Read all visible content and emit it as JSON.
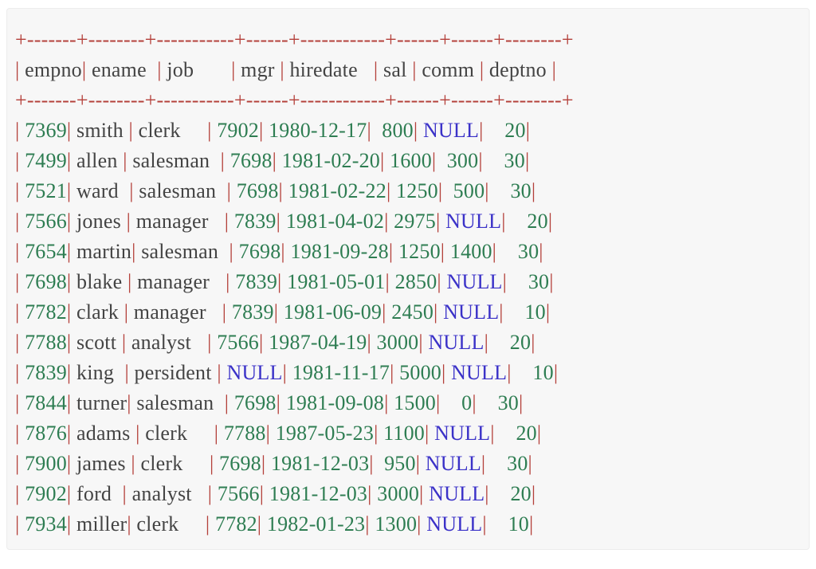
{
  "panel": {
    "background": "#f7f7f7",
    "border_color": "#ececec"
  },
  "colors": {
    "rule": "#b4403a",
    "pipe": "#b4403a",
    "label": "#444444",
    "number": "#2e7d52",
    "null": "#3b32c8"
  },
  "table": {
    "separator": "+-------+--------+-----------+------+------------+------+------+--------+",
    "columns": [
      "empno",
      "ename",
      "job",
      "mgr",
      "hiredate",
      "sal",
      "comm",
      "deptno"
    ],
    "column_pad": [
      "empno",
      "ename  ",
      "job       ",
      "mgr ",
      "hiredate   ",
      "sal ",
      "comm ",
      "deptno "
    ],
    "rows": [
      {
        "empno": "7369",
        "ename": "smith ",
        "job": "clerk     ",
        "mgr": "7902",
        "hiredate": "1980-12-17",
        "sal": " 800",
        "comm": "NULL",
        "deptno": "   20"
      },
      {
        "empno": "7499",
        "ename": "allen ",
        "job": "salesman  ",
        "mgr": "7698",
        "hiredate": "1981-02-20",
        "sal": "1600",
        "comm": " 300",
        "deptno": "   30"
      },
      {
        "empno": "7521",
        "ename": "ward  ",
        "job": "salesman  ",
        "mgr": "7698",
        "hiredate": "1981-02-22",
        "sal": "1250",
        "comm": " 500",
        "deptno": "   30"
      },
      {
        "empno": "7566",
        "ename": "jones ",
        "job": "manager   ",
        "mgr": "7839",
        "hiredate": "1981-04-02",
        "sal": "2975",
        "comm": "NULL",
        "deptno": "   20"
      },
      {
        "empno": "7654",
        "ename": "martin",
        "job": "salesman  ",
        "mgr": "7698",
        "hiredate": "1981-09-28",
        "sal": "1250",
        "comm": "1400",
        "deptno": "   30"
      },
      {
        "empno": "7698",
        "ename": "blake ",
        "job": "manager   ",
        "mgr": "7839",
        "hiredate": "1981-05-01",
        "sal": "2850",
        "comm": "NULL",
        "deptno": "   30"
      },
      {
        "empno": "7782",
        "ename": "clark ",
        "job": "manager   ",
        "mgr": "7839",
        "hiredate": "1981-06-09",
        "sal": "2450",
        "comm": "NULL",
        "deptno": "   10"
      },
      {
        "empno": "7788",
        "ename": "scott ",
        "job": "analyst   ",
        "mgr": "7566",
        "hiredate": "1987-04-19",
        "sal": "3000",
        "comm": "NULL",
        "deptno": "   20"
      },
      {
        "empno": "7839",
        "ename": "king  ",
        "job": "persident ",
        "mgr": "NULL",
        "hiredate": "1981-11-17",
        "sal": "5000",
        "comm": "NULL",
        "deptno": "   10"
      },
      {
        "empno": "7844",
        "ename": "turner",
        "job": "salesman  ",
        "mgr": "7698",
        "hiredate": "1981-09-08",
        "sal": "1500",
        "comm": "   0",
        "deptno": "   30"
      },
      {
        "empno": "7876",
        "ename": "adams ",
        "job": "clerk     ",
        "mgr": "7788",
        "hiredate": "1987-05-23",
        "sal": "1100",
        "comm": "NULL",
        "deptno": "   20"
      },
      {
        "empno": "7900",
        "ename": "james ",
        "job": "clerk     ",
        "mgr": "7698",
        "hiredate": "1981-12-03",
        "sal": " 950",
        "comm": "NULL",
        "deptno": "   30"
      },
      {
        "empno": "7902",
        "ename": "ford  ",
        "job": "analyst   ",
        "mgr": "7566",
        "hiredate": "1981-12-03",
        "sal": "3000",
        "comm": "NULL",
        "deptno": "   20"
      },
      {
        "empno": "7934",
        "ename": "miller",
        "job": "clerk     ",
        "mgr": "7782",
        "hiredate": "1982-01-23",
        "sal": "1300",
        "comm": "NULL",
        "deptno": "   10"
      }
    ]
  }
}
